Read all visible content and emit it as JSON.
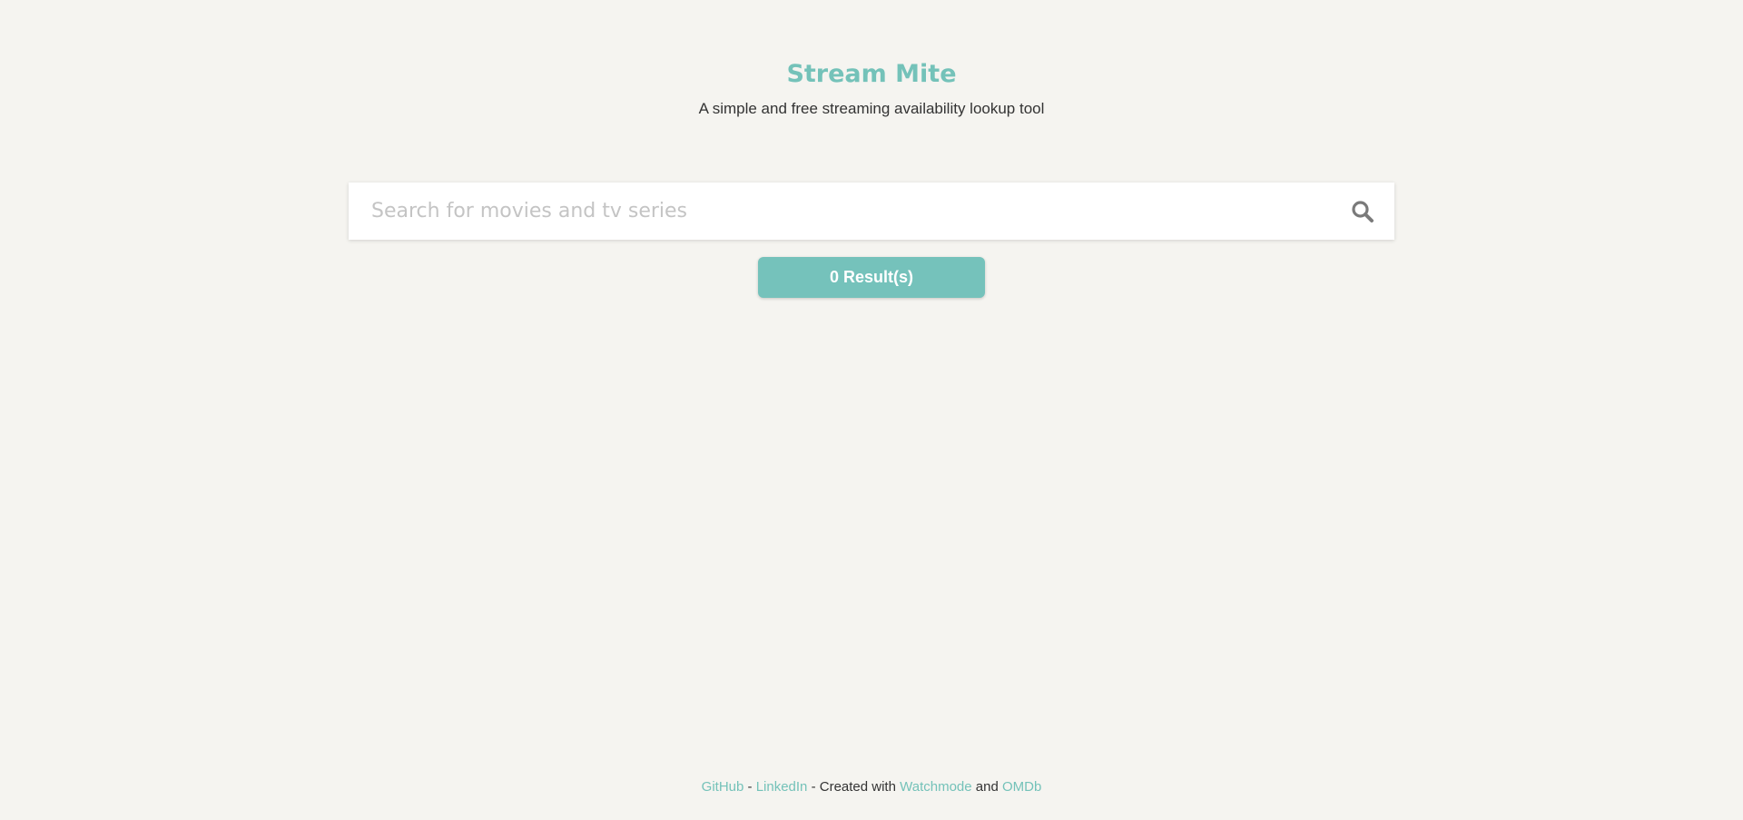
{
  "header": {
    "title": "Stream Mite",
    "subtitle": "A simple and free streaming availability lookup tool"
  },
  "search": {
    "placeholder": "Search for movies and tv series",
    "value": "",
    "icon": "search-icon"
  },
  "results": {
    "label": "0 Result(s)"
  },
  "footer": {
    "github": "GitHub",
    "sep1": " - ",
    "linkedin": "LinkedIn",
    "created_with": " - Created with ",
    "watchmode": "Watchmode",
    "and": " and ",
    "omdb": "OMDb"
  },
  "colors": {
    "accent": "#74c2b9",
    "background": "#f5f4f0",
    "text": "#333333"
  }
}
